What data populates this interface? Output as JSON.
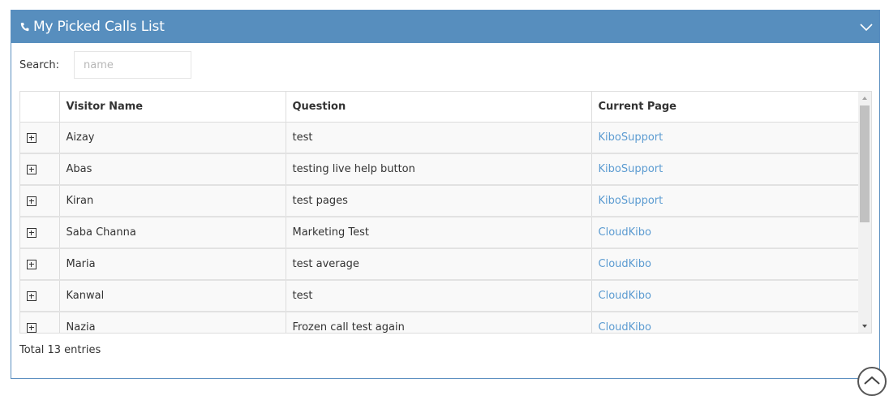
{
  "portlet": {
    "title": "My Picked Calls List",
    "icon": "phone-icon",
    "collapse_icon": "chevron-down-icon",
    "header_color": "#578ebe"
  },
  "search": {
    "label": "Search:",
    "value": "",
    "placeholder": "name"
  },
  "table": {
    "columns": [
      "",
      "Visitor Name",
      "Question",
      "Current Page"
    ],
    "rows": [
      {
        "visitor_name": "Aizay",
        "question": "test",
        "current_page": "KiboSupport"
      },
      {
        "visitor_name": "Abas",
        "question": "testing live help button",
        "current_page": "KiboSupport"
      },
      {
        "visitor_name": "Kiran",
        "question": "test pages",
        "current_page": "KiboSupport"
      },
      {
        "visitor_name": "Saba Channa",
        "question": "Marketing Test",
        "current_page": "CloudKibo"
      },
      {
        "visitor_name": "Maria",
        "question": "test average",
        "current_page": "CloudKibo"
      },
      {
        "visitor_name": "Kanwal",
        "question": "test",
        "current_page": "CloudKibo"
      },
      {
        "visitor_name": "Nazia",
        "question": "Frozen call test again",
        "current_page": "CloudKibo"
      }
    ]
  },
  "footer": {
    "total_text": "Total 13 entries"
  },
  "scroll_top_icon": "chevron-up-icon",
  "colors": {
    "link": "#5b9bd1",
    "border": "#5b8fc0"
  }
}
